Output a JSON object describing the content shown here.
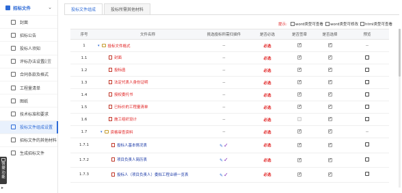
{
  "sidebar": {
    "header": "招标文件",
    "items": [
      {
        "label": "封面",
        "icon": "cover-icon"
      },
      {
        "label": "招标公告",
        "icon": "announcement-icon"
      },
      {
        "label": "投标人须知",
        "icon": "notice-icon"
      },
      {
        "label": "评标办法设置",
        "icon": "person-icon",
        "gear": "设置"
      },
      {
        "label": "合同条款及格式",
        "icon": "contract-icon"
      },
      {
        "label": "工程量清单",
        "icon": "list-icon"
      },
      {
        "label": "图纸",
        "icon": "drawing-icon"
      },
      {
        "label": "技术标准和要求",
        "icon": "standard-icon"
      },
      {
        "label": "投标文件组成设置",
        "icon": "folder-icon",
        "active": true
      },
      {
        "label": "招标文件的其他材料",
        "icon": "materials-icon"
      },
      {
        "label": "生成招标文件",
        "icon": "generate-icon"
      }
    ],
    "quick_panel": "快捷功能"
  },
  "tabs": [
    {
      "label": "投标文件组成",
      "active": true
    },
    {
      "label": "投标所需其他材料",
      "active": false
    }
  ],
  "legend": {
    "tip": "提示:",
    "items": [
      "word类型可查看",
      "word类型可修改",
      "html类型可查看"
    ]
  },
  "table": {
    "headers": [
      "序号",
      "文件名称",
      "挑选投标所需扫描件",
      "是否必选",
      "是否签章",
      "是否选择",
      "预览"
    ],
    "rows": [
      {
        "no": "1",
        "name": "投标文件格式",
        "level": 0,
        "folder": true,
        "name_color": "red",
        "att": "--",
        "req": "必选",
        "sign": true,
        "select": true,
        "sign_dim": false,
        "preview": "--"
      },
      {
        "no": "1.1",
        "name": "封面",
        "level": 1,
        "folder": false,
        "name_color": "red",
        "att": "--",
        "req": "必选",
        "sign": true,
        "select": true,
        "sign_dim": false,
        "preview": "icon"
      },
      {
        "no": "1.2",
        "name": "投标函",
        "level": 1,
        "folder": false,
        "name_color": "red",
        "att": "--",
        "req": "必选",
        "sign": true,
        "select": true,
        "sign_dim": false,
        "preview": "icon"
      },
      {
        "no": "1.3",
        "name": "法定代表人身份证明",
        "level": 1,
        "folder": false,
        "name_color": "red",
        "att": "--",
        "req": "必选",
        "sign": true,
        "select": true,
        "sign_dim": false,
        "preview": "icon"
      },
      {
        "no": "1.4",
        "name": "授权委托书",
        "level": 1,
        "folder": false,
        "name_color": "red",
        "att": "--",
        "req": "必选",
        "sign": true,
        "select": true,
        "sign_dim": false,
        "preview": "icon"
      },
      {
        "no": "1.5",
        "name": "已标价的工程量清单",
        "level": 1,
        "folder": false,
        "name_color": "red",
        "att": "--",
        "req": "必选",
        "sign": true,
        "select": true,
        "sign_dim": false,
        "preview": "icon"
      },
      {
        "no": "1.6",
        "name": "施工组织设计",
        "level": 1,
        "folder": false,
        "name_color": "red",
        "att": "--",
        "req": "必选",
        "sign": false,
        "select": true,
        "sign_dim": true,
        "preview": "icon"
      },
      {
        "no": "1.7",
        "name": "资格审查资料",
        "level": 1,
        "folder": true,
        "name_color": "red",
        "att": "--",
        "req": "必选",
        "sign": true,
        "select": true,
        "sign_dim": false,
        "preview": "--"
      },
      {
        "no": "1.7.1",
        "name": "投标人基本情况表",
        "level": 2,
        "folder": false,
        "name_color": "blue",
        "att": "edit",
        "req": "必选",
        "sign": true,
        "select": true,
        "sign_dim": false,
        "preview": "icon"
      },
      {
        "no": "1.7.2",
        "name": "项目负责人简历表",
        "level": 2,
        "folder": false,
        "name_color": "blue",
        "att": "edit",
        "req": "必选",
        "sign": true,
        "select": true,
        "sign_dim": false,
        "preview": "icon"
      },
      {
        "no": "1.7.3",
        "name": "投标人（项目负责人）委拟工程业绩一览表",
        "level": 2,
        "folder": false,
        "name_color": "blue",
        "att": "edit",
        "req": "必选",
        "sign": true,
        "select": true,
        "sign_dim": false,
        "preview": "icon"
      }
    ]
  }
}
